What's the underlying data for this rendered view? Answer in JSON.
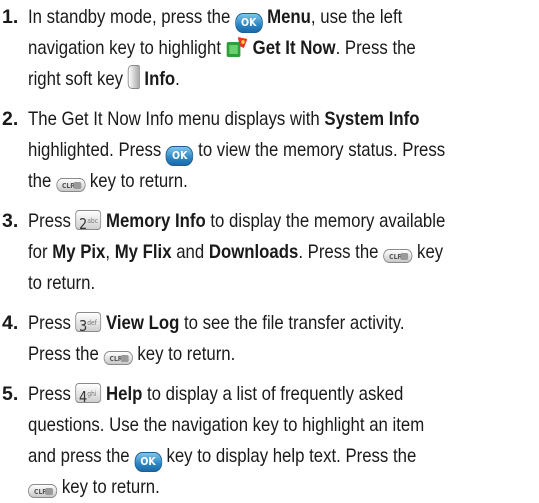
{
  "steps": [
    {
      "number": "1.",
      "parts": {
        "a": "In standby mode, press the",
        "b": "Menu",
        "c": ", use the left",
        "d": "navigation key to highlight",
        "e": "Get It Now",
        "f": ". Press the",
        "g": "right soft key",
        "h": "Info",
        "i": "."
      }
    },
    {
      "number": "2.",
      "parts": {
        "a": "The Get It Now Info menu displays with",
        "b": "System Info",
        "c": "highlighted. Press",
        "d": "to view the memory status. Press",
        "e": "the",
        "f": "key to return."
      }
    },
    {
      "number": "3.",
      "parts": {
        "a": "Press",
        "b": "Memory Info",
        "c": "to display the memory available",
        "d": "for",
        "e": "My Pix",
        "f": ",",
        "g": "My Flix",
        "h": "and",
        "i": "Downloads",
        "j": ". Press the",
        "k": "key",
        "l": "to return."
      }
    },
    {
      "number": "4.",
      "parts": {
        "a": "Press",
        "b": "View Log",
        "c": "to see the file transfer activity.",
        "d": "Press the",
        "e": "key to return."
      }
    },
    {
      "number": "5.",
      "parts": {
        "a": "Press",
        "b": "Help",
        "c": "to display a list of frequently asked",
        "d": "questions. Use the navigation key to highlight an item",
        "e": "and press the",
        "f": "key to display help text. Press the",
        "g": "key to return."
      }
    }
  ],
  "keys": {
    "ok": "OK",
    "clr": "CLR",
    "two": "2",
    "two_sub": "abc",
    "three": "3",
    "three_sub": "def",
    "four": "4",
    "four_sub": "ghi"
  }
}
